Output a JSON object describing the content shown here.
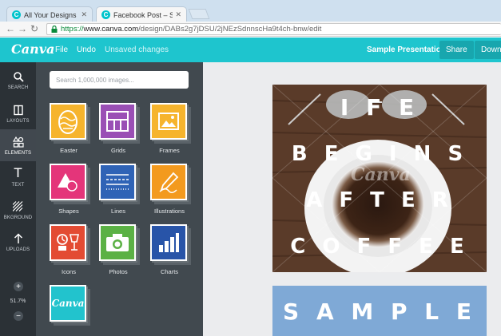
{
  "browser": {
    "tabs": [
      {
        "title": "All Your Designs – Canva",
        "favicon": "C",
        "active": false
      },
      {
        "title": "Facebook Post – Sample P",
        "favicon": "C",
        "active": true
      }
    ],
    "url_https": "https://",
    "url_domain": "www.canva.com",
    "url_path": "/design/DABs2g7jDSU/2jNEzSdnnscHa9t4ch-bnw/edit"
  },
  "header": {
    "logo": "Canva",
    "file": "File",
    "undo": "Undo",
    "status": "Unsaved changes",
    "design_title": "Sample Presentation",
    "share": "Share",
    "download": "Downl"
  },
  "rail": {
    "items": [
      {
        "label": "SEARCH",
        "icon": "search-icon"
      },
      {
        "label": "LAYOUTS",
        "icon": "layouts-icon"
      },
      {
        "label": "ELEMENTS",
        "icon": "elements-icon"
      },
      {
        "label": "TEXT",
        "icon": "text-icon"
      },
      {
        "label": "BKGROUND",
        "icon": "background-icon"
      },
      {
        "label": "UPLOADS",
        "icon": "upload-icon"
      }
    ],
    "zoom_in": "+",
    "zoom": "51.7%",
    "zoom_out": "−"
  },
  "panel": {
    "search_placeholder": "Search 1,000,000 images...",
    "tiles": [
      {
        "label": "Easter",
        "color": "#f6b42d",
        "icon": "egg-icon"
      },
      {
        "label": "Grids",
        "color": "#9a4fb5",
        "icon": "grid-icon"
      },
      {
        "label": "Frames",
        "color": "#f6b42d",
        "icon": "frame-icon"
      },
      {
        "label": "Shapes",
        "color": "#e4357a",
        "icon": "shapes-icon"
      },
      {
        "label": "Lines",
        "color": "#2f63b6",
        "icon": "lines-icon"
      },
      {
        "label": "Illustrations",
        "color": "#f39a1e",
        "icon": "pencil-icon"
      },
      {
        "label": "Icons",
        "color": "#e34b33",
        "icon": "icons-icon"
      },
      {
        "label": "Photos",
        "color": "#5bb145",
        "icon": "camera-icon"
      },
      {
        "label": "Charts",
        "color": "#2854a8",
        "icon": "bar-chart-icon"
      },
      {
        "label": "Canva",
        "color": "#22c3cd",
        "icon": "canva-logo-icon"
      }
    ]
  },
  "canvas": {
    "page1_lines": [
      "I F E",
      "B E G I N S",
      "A F T E R",
      "C O F F E E"
    ],
    "watermark": "Canva",
    "page2_text": "S A M P L E"
  }
}
